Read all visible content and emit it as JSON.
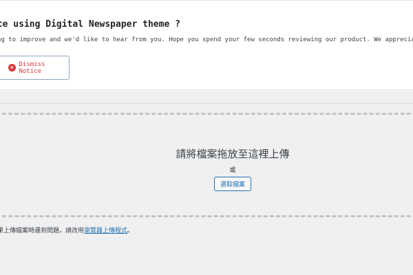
{
  "notice": {
    "title": "nce using Digital Newspaper theme ?",
    "text": "ng to improve and we'd like to hear from you. Hope you spend your few seconds reviewing our product. We appreciate your time and",
    "dismiss_label": "Dismiss Notice",
    "dismiss_icon_glyph": "✕",
    "dismiss_color": "#d63638"
  },
  "uploader": {
    "drop_title": "請將檔案拖放至這裡上傳",
    "or_text": "或",
    "select_button_label": "選取檔案",
    "help_prefix": "果上傳檔案時遇到問題，請改用",
    "help_link": "瀏覽器上傳程式",
    "help_suffix": "。",
    "link_color": "#2271b1"
  }
}
